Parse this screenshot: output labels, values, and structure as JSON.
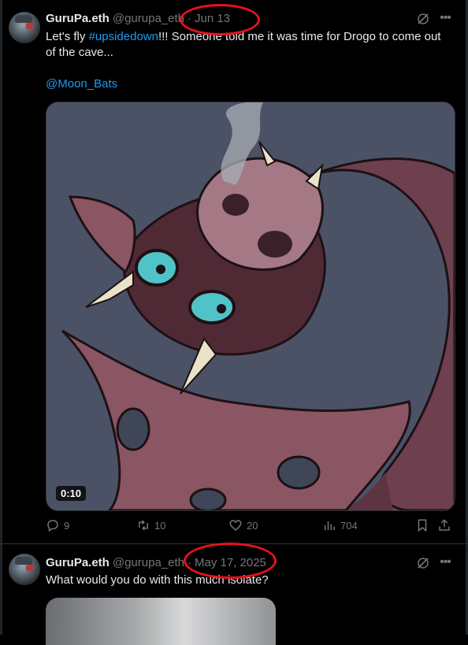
{
  "tweets": [
    {
      "display_name": "GuruPa.eth",
      "handle": "@gurupa_eth",
      "separator": "·",
      "date": "Jun 13",
      "text_before": "Let's fly ",
      "hashtag": "#upsidedown",
      "text_after": "!!! Someone told me it was time for Drogo to come out of the cave...",
      "mention": "@Moon_Bats",
      "video_duration": "0:10",
      "actions": {
        "replies": "9",
        "reposts": "10",
        "likes": "20",
        "views": "704"
      }
    },
    {
      "display_name": "GuruPa.eth",
      "handle": "@gurupa_eth",
      "separator": "·",
      "date": "May 17, 2025",
      "text": "What would you do with this much isolate?"
    }
  ],
  "icons": {
    "grok": "grok-icon",
    "more": "more-icon",
    "reply": "reply-icon",
    "repost": "repost-icon",
    "like": "heart-icon",
    "views": "analytics-icon",
    "bookmark": "bookmark-icon",
    "share": "share-icon"
  },
  "colors": {
    "background": "#000000",
    "text": "#e7e9ea",
    "muted": "#71767b",
    "link": "#1d9bf0",
    "annotation": "#e8121d"
  }
}
